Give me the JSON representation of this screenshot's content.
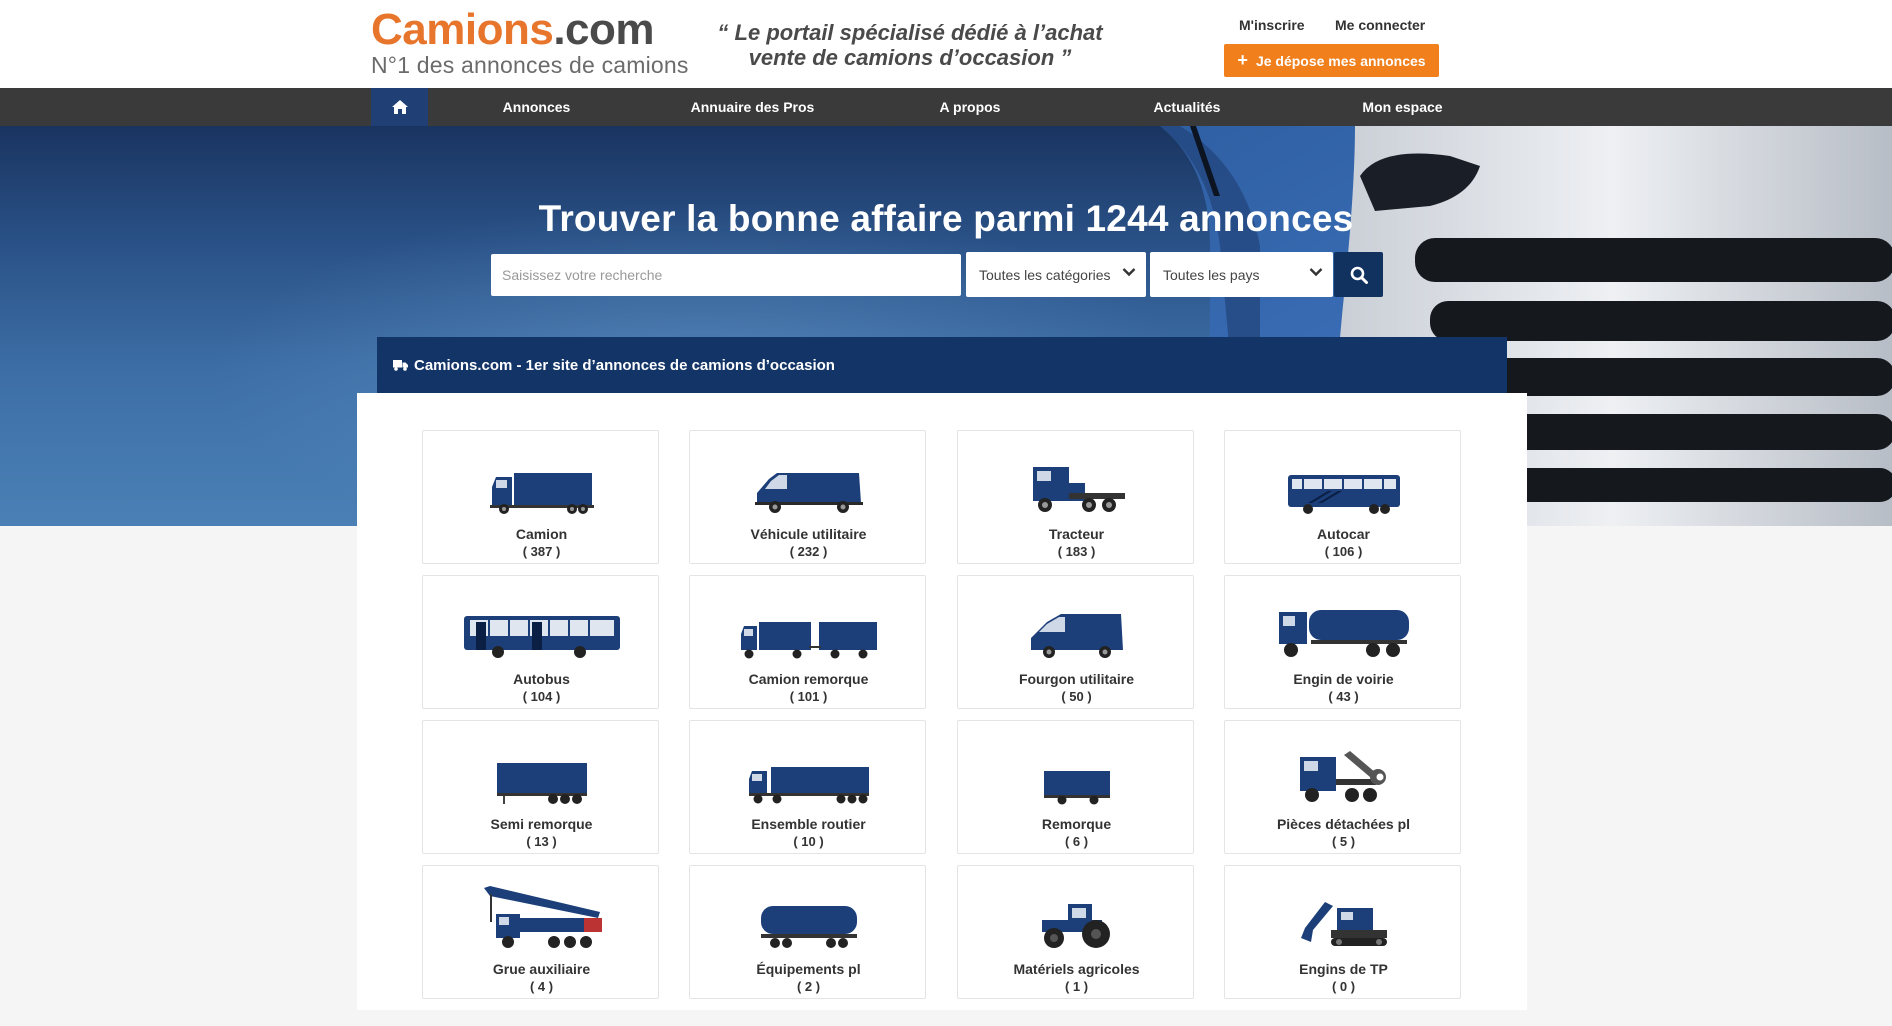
{
  "header": {
    "logo_brand": "Camions",
    "logo_tld": ".com",
    "logo_tagline": "N°1 des annonces de camions",
    "slogan_line1": "“ Le portail spécialisé dédié à l’achat",
    "slogan_line2": "vente de camions d’occasion ”",
    "register_label": "M'inscrire",
    "login_label": "Me connecter",
    "post_ad_label": "Je dépose mes annonces",
    "post_ad_icon": "plus-icon"
  },
  "nav": {
    "home_icon": "home-icon",
    "items": [
      {
        "label": "Annonces"
      },
      {
        "label": "Annuaire des Pros"
      },
      {
        "label": "A propos"
      },
      {
        "label": "Actualités"
      },
      {
        "label": "Mon espace"
      }
    ]
  },
  "hero": {
    "title": "Trouver la bonne affaire parmi 1244 annonces",
    "search_placeholder": "Saisissez votre recherche",
    "category_select": "Toutes les catégories",
    "country_select": "Toutes les pays",
    "search_icon": "search-icon"
  },
  "panel": {
    "title": "Camions.com - 1er site d’annonces de camions d’occasion",
    "title_icon": "truck-icon",
    "categories": [
      {
        "name": "Camion",
        "count": "( 387 )",
        "icon": "box-truck-icon"
      },
      {
        "name": "Véhicule utilitaire",
        "count": "( 232 )",
        "icon": "van-icon"
      },
      {
        "name": "Tracteur",
        "count": "( 183 )",
        "icon": "tractor-unit-icon"
      },
      {
        "name": "Autocar",
        "count": "( 106 )",
        "icon": "coach-icon"
      },
      {
        "name": "Autobus",
        "count": "( 104 )",
        "icon": "city-bus-icon"
      },
      {
        "name": "Camion remorque",
        "count": "( 101 )",
        "icon": "truck-trailer-icon"
      },
      {
        "name": "Fourgon utilitaire",
        "count": "( 50 )",
        "icon": "cargo-van-icon"
      },
      {
        "name": "Engin de voirie",
        "count": "( 43 )",
        "icon": "road-tanker-icon"
      },
      {
        "name": "Semi remorque",
        "count": "( 13 )",
        "icon": "semi-trailer-icon"
      },
      {
        "name": "Ensemble routier",
        "count": "( 10 )",
        "icon": "road-train-icon"
      },
      {
        "name": "Remorque",
        "count": "( 6 )",
        "icon": "trailer-icon"
      },
      {
        "name": "Pièces détachées pl",
        "count": "( 5 )",
        "icon": "parts-wrench-icon"
      },
      {
        "name": "Grue auxiliaire",
        "count": "( 4 )",
        "icon": "crane-truck-icon"
      },
      {
        "name": "Équipements pl",
        "count": "( 2 )",
        "icon": "tank-trailer-icon"
      },
      {
        "name": "Matériels agricoles",
        "count": "( 1 )",
        "icon": "farm-tractor-icon"
      },
      {
        "name": "Engins de TP",
        "count": "( 0 )",
        "icon": "excavator-icon"
      }
    ]
  },
  "colors": {
    "brand_orange": "#e8752c",
    "button_orange": "#f07f1c",
    "navy": "#133467",
    "nav_dark": "#3a3a3a",
    "vehicle_blue": "#1c3f7a"
  }
}
